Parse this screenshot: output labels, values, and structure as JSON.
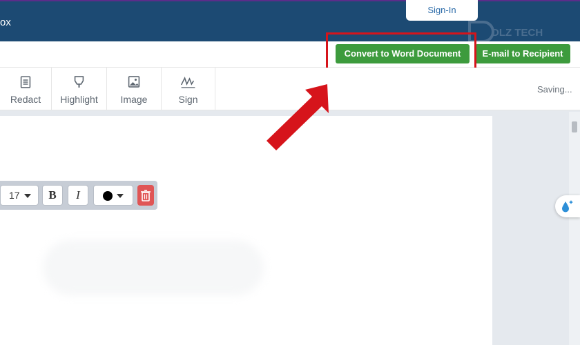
{
  "header": {
    "title_fragment": "ox",
    "signin_label": "Sign-In",
    "watermark_text": "DLZ TECH"
  },
  "actions": {
    "convert_label": "Convert to Word Document",
    "email_label": "E-mail to Recipient"
  },
  "tools": [
    {
      "label": "Redact",
      "icon": "redact-icon"
    },
    {
      "label": "Highlight",
      "icon": "highlight-icon"
    },
    {
      "label": "Image",
      "icon": "image-icon"
    },
    {
      "label": "Sign",
      "icon": "sign-icon"
    }
  ],
  "status": {
    "saving_text": "Saving..."
  },
  "format_toolbar": {
    "font_size": "17",
    "bold_label": "B",
    "italic_label": "I",
    "text_color": "#000000"
  },
  "colors": {
    "header_bg": "#1c4a73",
    "button_green": "#3d9b3d",
    "annotation_red": "#d6141b",
    "delete_red": "#e05555"
  }
}
